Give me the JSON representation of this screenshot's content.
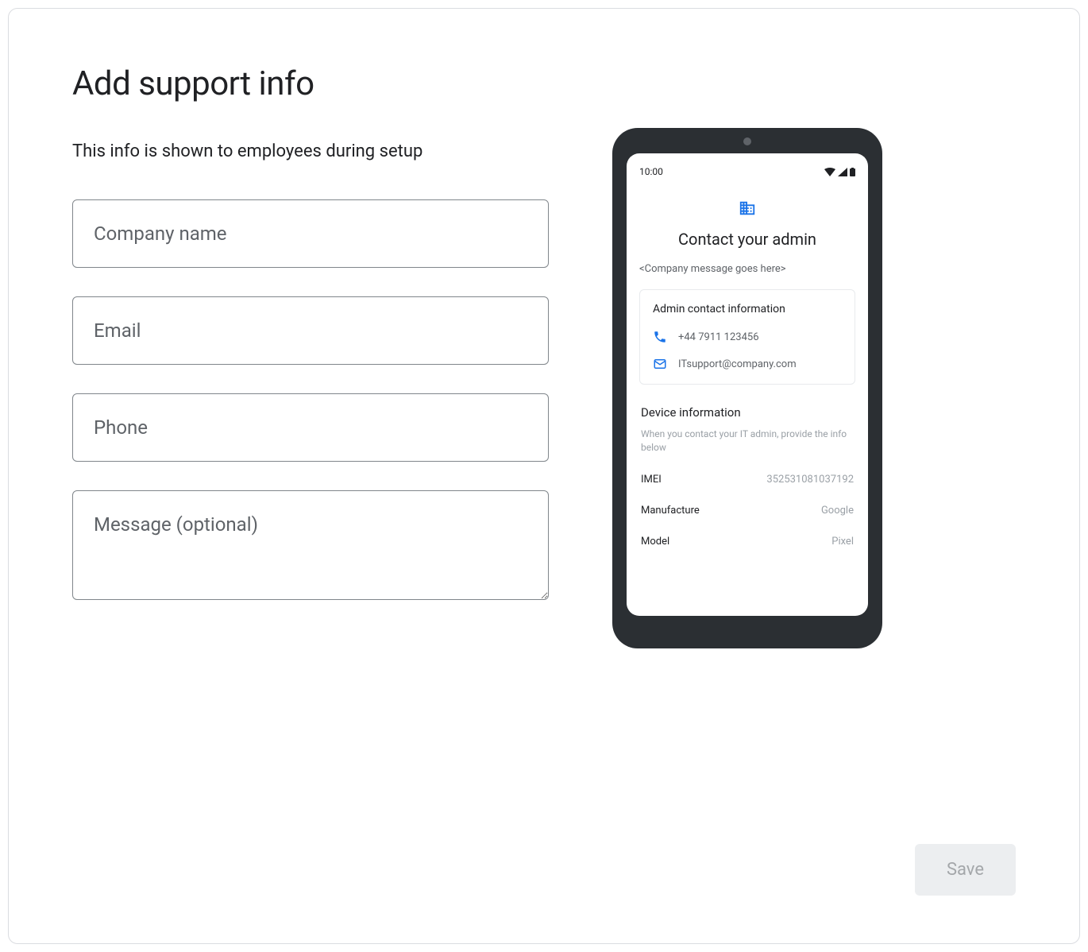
{
  "page": {
    "title": "Add support info",
    "subtitle": "This info is shown to employees during setup"
  },
  "form": {
    "company_name_placeholder": "Company name",
    "email_placeholder": "Email",
    "phone_placeholder": "Phone",
    "message_placeholder": "Message (optional)"
  },
  "preview": {
    "time": "10:00",
    "title": "Contact your admin",
    "message_placeholder": "<Company message goes here>",
    "contact_heading": "Admin contact information",
    "phone": "+44 7911 123456",
    "email": "ITsupport@company.com",
    "device_heading": "Device information",
    "device_subtitle": "When you contact your IT admin, provide the info below",
    "device_rows": [
      {
        "label": "IMEI",
        "value": "352531081037192"
      },
      {
        "label": "Manufacture",
        "value": "Google"
      },
      {
        "label": "Model",
        "value": "Pixel"
      }
    ]
  },
  "actions": {
    "save_label": "Save"
  }
}
